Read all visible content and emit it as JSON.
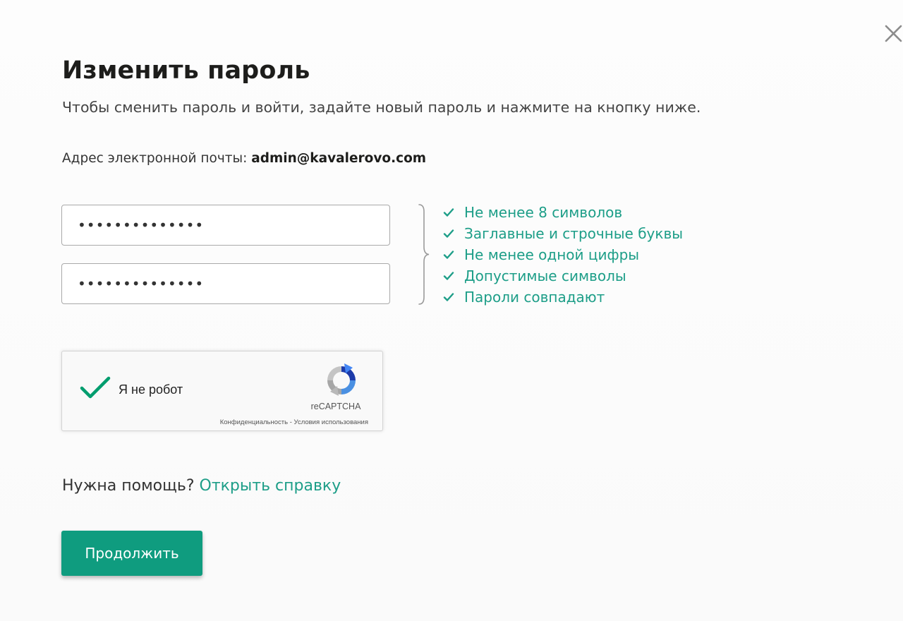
{
  "dialog": {
    "title": "Изменить пароль",
    "subtitle": "Чтобы сменить пароль и войти, задайте новый пароль и нажмите на кнопку ниже.",
    "close_icon": "close-icon"
  },
  "email": {
    "label": "Адрес электронной почты:",
    "value": "admin@kavalerovo.com"
  },
  "password": {
    "new_value": "••••••••••••••",
    "confirm_value": "••••••••••••••"
  },
  "requirements": [
    {
      "text": "Не менее 8 символов",
      "met": true
    },
    {
      "text": "Заглавные и строчные буквы",
      "met": true
    },
    {
      "text": "Не менее одной цифры",
      "met": true
    },
    {
      "text": "Допустимые символы",
      "met": true
    },
    {
      "text": "Пароли совпадают",
      "met": true
    }
  ],
  "captcha": {
    "label": "Я не робот",
    "checked": true,
    "brand": "reCAPTCHA",
    "privacy_link": "Конфиденциальность",
    "separator": " - ",
    "terms_link": "Условия использования"
  },
  "help": {
    "question": "Нужна помощь?",
    "link": "Открыть справку"
  },
  "actions": {
    "continue_label": "Продолжить"
  },
  "colors": {
    "accent": "#0f9c7f",
    "success_text": "#1d9e88",
    "captcha_check": "#009d6e"
  }
}
